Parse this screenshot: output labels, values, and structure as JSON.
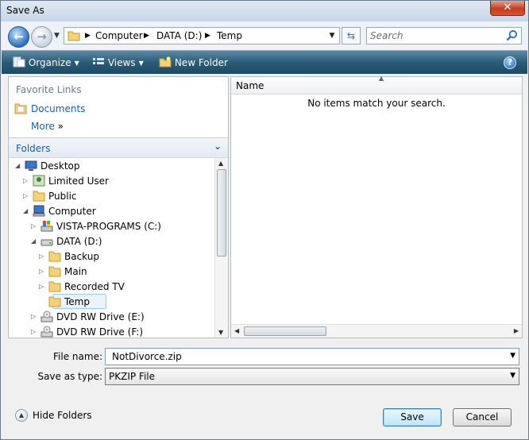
{
  "window": {
    "title": "Save As",
    "close_label": "✕"
  },
  "address": {
    "crumbs": [
      "Computer",
      "DATA (D:)",
      "Temp"
    ],
    "search_placeholder": "Search"
  },
  "toolbar": {
    "organize": "Organize",
    "views": "Views",
    "new_folder": "New Folder",
    "help": "?"
  },
  "favorites": {
    "header": "Favorite Links",
    "items": [
      "Documents"
    ],
    "more": "More",
    "more_chevron": "»"
  },
  "folders": {
    "header": "Folders",
    "tree": [
      {
        "label": "Desktop",
        "expander": "◢",
        "icon": "desktop-icon"
      },
      {
        "label": "Limited User",
        "expander": "▷",
        "icon": "user-folder-icon"
      },
      {
        "label": "Public",
        "expander": "▷",
        "icon": "folder-icon"
      },
      {
        "label": "Computer",
        "expander": "◢",
        "icon": "computer-icon"
      },
      {
        "label": "VISTA-PROGRAMS (C:)",
        "expander": "▷",
        "icon": "windows-drive-icon"
      },
      {
        "label": "DATA (D:)",
        "expander": "◢",
        "icon": "drive-icon"
      },
      {
        "label": "Backup",
        "expander": "▷",
        "icon": "folder-icon"
      },
      {
        "label": "Main",
        "expander": "▷",
        "icon": "folder-icon"
      },
      {
        "label": "Recorded TV",
        "expander": "▷",
        "icon": "folder-icon"
      },
      {
        "label": "Temp",
        "expander": "",
        "icon": "folder-icon",
        "selected": true
      },
      {
        "label": "DVD RW Drive (E:)",
        "expander": "▷",
        "icon": "dvd-drive-icon"
      },
      {
        "label": "DVD RW Drive (F:)",
        "expander": "▷",
        "icon": "dvd-drive-icon"
      }
    ]
  },
  "file_list": {
    "column_name": "Name",
    "empty_message": "No items match your search."
  },
  "form": {
    "filename_label": "File name:",
    "filename_value": "NotDivorce.zip",
    "type_label": "Save as type:",
    "type_value": "PKZIP File"
  },
  "footer": {
    "hide_folders": "Hide Folders",
    "save": "Save",
    "cancel": "Cancel"
  }
}
